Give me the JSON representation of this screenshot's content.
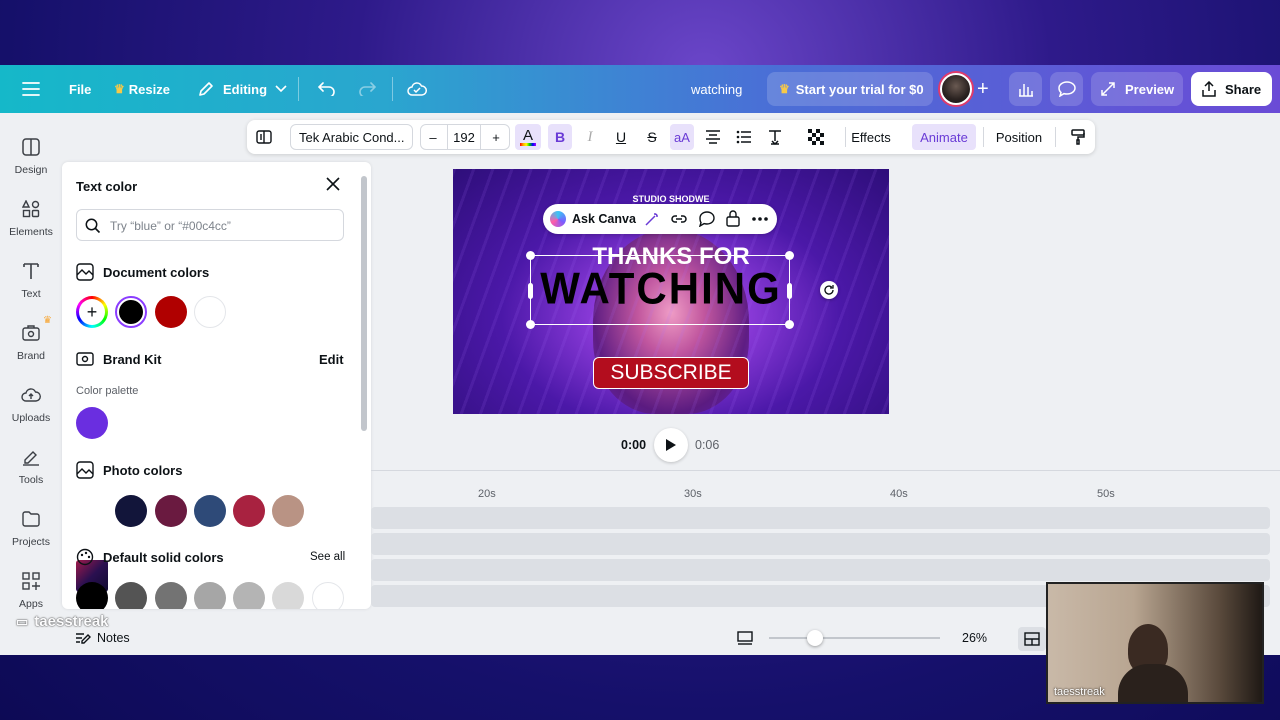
{
  "topbar": {
    "file": "File",
    "resize": "Resize",
    "editing": "Editing",
    "doc_title": "watching",
    "trial": "Start your trial for $0",
    "preview": "Preview",
    "share": "Share"
  },
  "toolbar": {
    "font": "Tek Arabic Cond...",
    "minus": "–",
    "size": "192",
    "plus": "+",
    "bold": "B",
    "italic": "I",
    "underline": "U",
    "strike": "S",
    "case": "aA",
    "effects": "Effects",
    "animate": "Animate",
    "position": "Position"
  },
  "rail": [
    {
      "label": "Design",
      "icon": "design-icon"
    },
    {
      "label": "Elements",
      "icon": "elements-icon"
    },
    {
      "label": "Text",
      "icon": "text-icon"
    },
    {
      "label": "Brand",
      "icon": "brand-icon"
    },
    {
      "label": "Uploads",
      "icon": "uploads-icon"
    },
    {
      "label": "Tools",
      "icon": "tools-icon"
    },
    {
      "label": "Projects",
      "icon": "projects-icon"
    },
    {
      "label": "Apps",
      "icon": "apps-icon"
    }
  ],
  "panel": {
    "title": "Text color",
    "search_placeholder": "Try “blue” or “#00c4cc”",
    "document_colors": "Document colors",
    "document_swatches": [
      "#000000",
      "#b00000",
      "#ffffff"
    ],
    "brand_kit": "Brand Kit",
    "edit": "Edit",
    "color_palette": "Color palette",
    "palette_swatches": [
      "#6a2ee0"
    ],
    "photo_colors": "Photo colors",
    "photo_swatches": [
      "#12153a",
      "#6a1a40",
      "#2e4a78",
      "#a82240",
      "#b99384"
    ],
    "default_solid": "Default solid colors",
    "see_all": "See all",
    "default_swatches": [
      "#000000",
      "#545454",
      "#737373",
      "#a6a6a6",
      "#b4b4b4",
      "#d9d9d9",
      "#ffffff"
    ]
  },
  "canvas": {
    "studio": "STUDIO SHODWE",
    "thanks": "THANKS FOR",
    "watching": "WATCHING",
    "subscribe": "SUBSCRIBE"
  },
  "floating": {
    "ask_canva": "Ask Canva"
  },
  "playback": {
    "current": "0:00",
    "duration": "0:06"
  },
  "timeline": {
    "ticks": [
      "20s",
      "30s",
      "40s",
      "50s"
    ]
  },
  "bottom": {
    "notes": "Notes",
    "zoom": "26%"
  },
  "overlay": {
    "watermark": "taesstreak",
    "cam_name": "taesstreak"
  },
  "colors": {
    "accent": "#8b3dff",
    "selected_swatch": "#000000"
  }
}
